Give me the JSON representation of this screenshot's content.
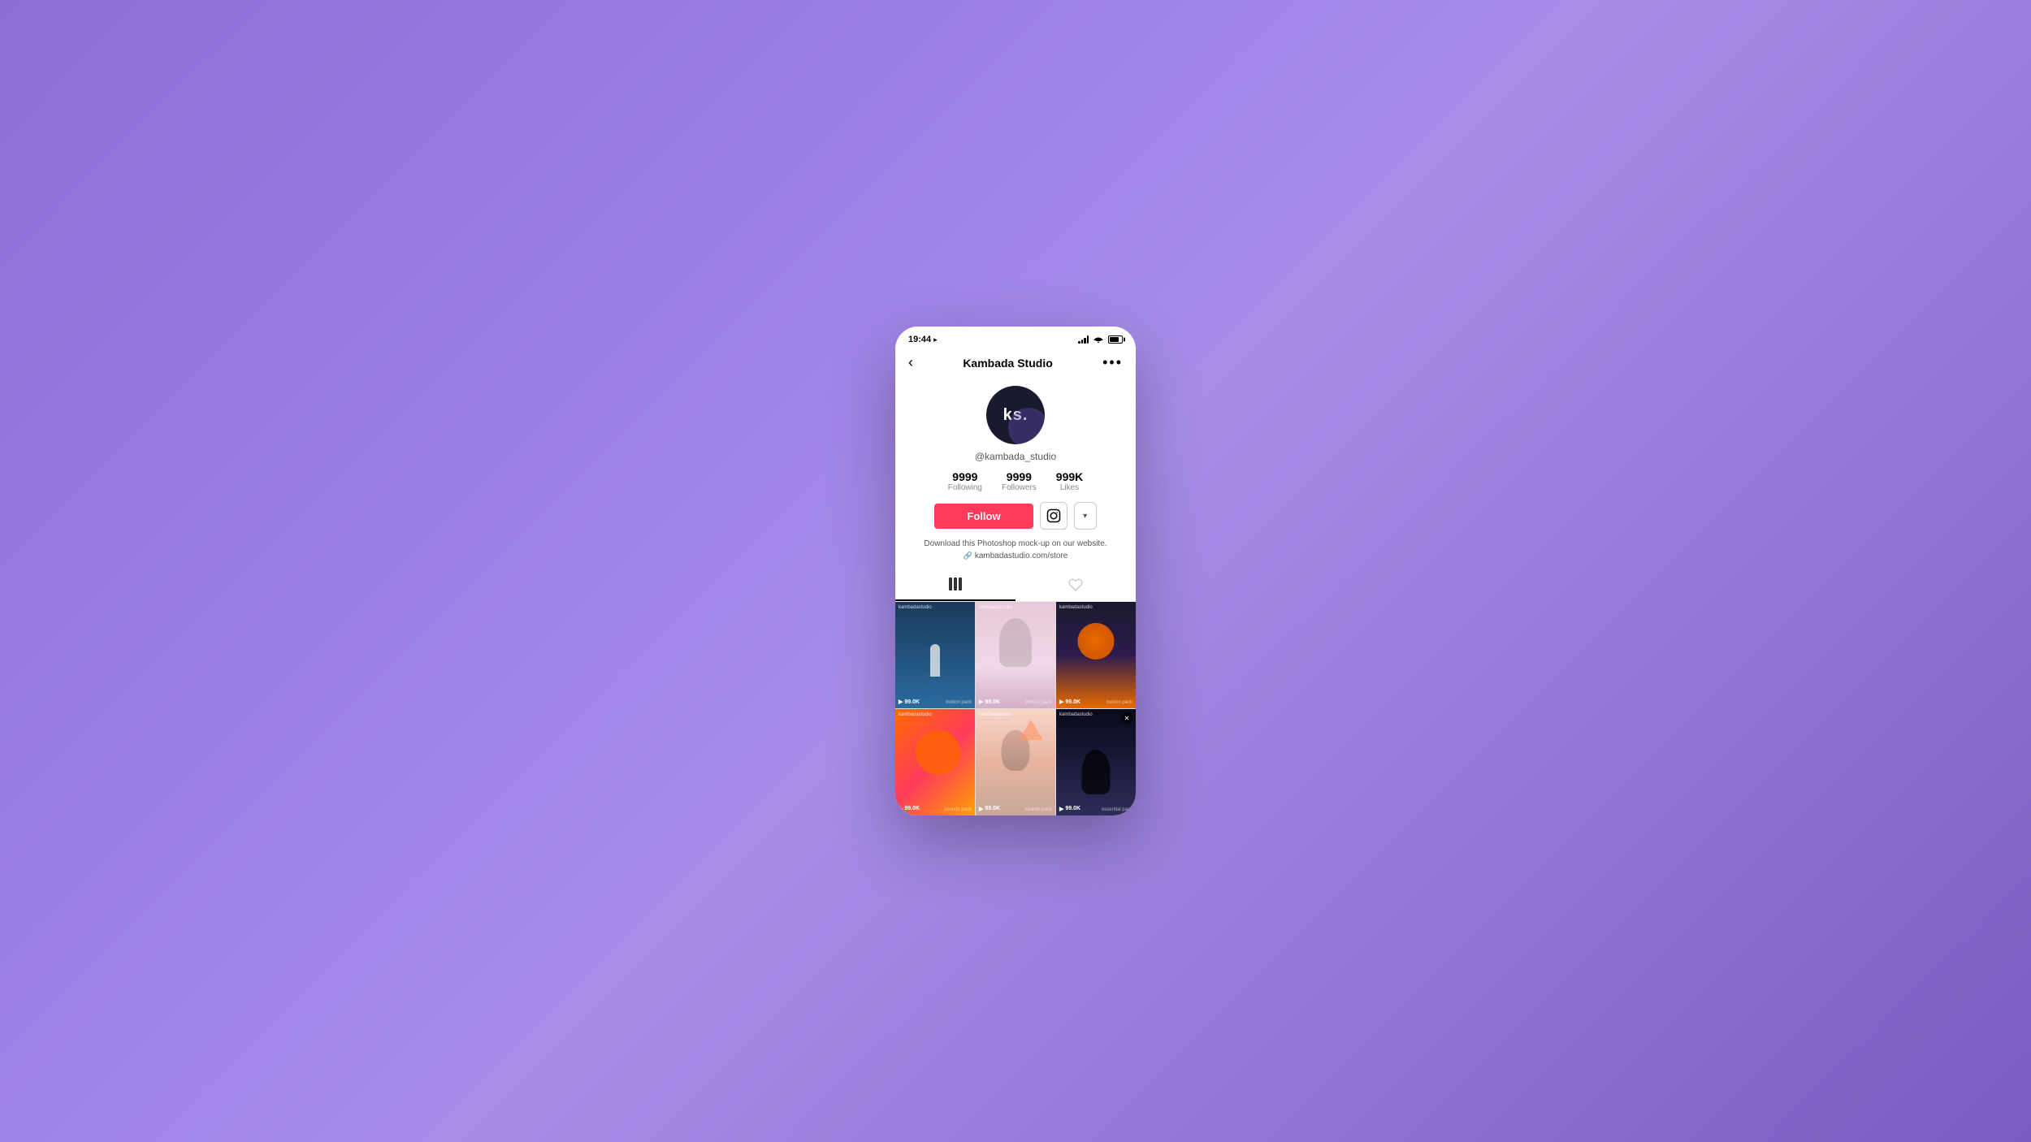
{
  "background": {
    "color_start": "#8b6fd4",
    "color_end": "#7c5cbf"
  },
  "status_bar": {
    "time": "19:44",
    "location_icon": "▶",
    "battery_percent": 75
  },
  "nav": {
    "back_label": "‹",
    "title": "Kambada Studio",
    "more_label": "•••"
  },
  "profile": {
    "avatar_text": "ks.",
    "username": "@kambada_studio",
    "stats": [
      {
        "value": "9999",
        "label": "Following"
      },
      {
        "value": "9999",
        "label": "Followers"
      },
      {
        "value": "999K",
        "label": "Likes"
      }
    ],
    "follow_button": "Follow",
    "bio_text": "Download this Photoshop mock-up on our website.",
    "bio_link": "kambadastudio.com/store"
  },
  "tabs": [
    {
      "icon": "grid",
      "active": true
    },
    {
      "icon": "heart",
      "active": false
    }
  ],
  "videos": [
    {
      "label": "kambadastudio",
      "badge": "",
      "views": "99.0K",
      "footer": "motion pack",
      "close": false
    },
    {
      "label": "kambadastudio",
      "badge": "",
      "views": "99.0K",
      "footer": "motion pack",
      "close": false
    },
    {
      "label": "kambadastudio",
      "badge": "",
      "views": "99.0K",
      "footer": "motion pack",
      "close": false
    },
    {
      "label": "kambadastudio",
      "badge": "",
      "views": "99.0K",
      "footer": "sounds pack",
      "close": false
    },
    {
      "label": "kambadastudio",
      "badge": "",
      "views": "99.0K",
      "footer": "sounds pack",
      "close": false
    },
    {
      "label": "kambadastudio",
      "badge": "x",
      "views": "99.0K",
      "footer": "essential pack",
      "close": true
    }
  ]
}
